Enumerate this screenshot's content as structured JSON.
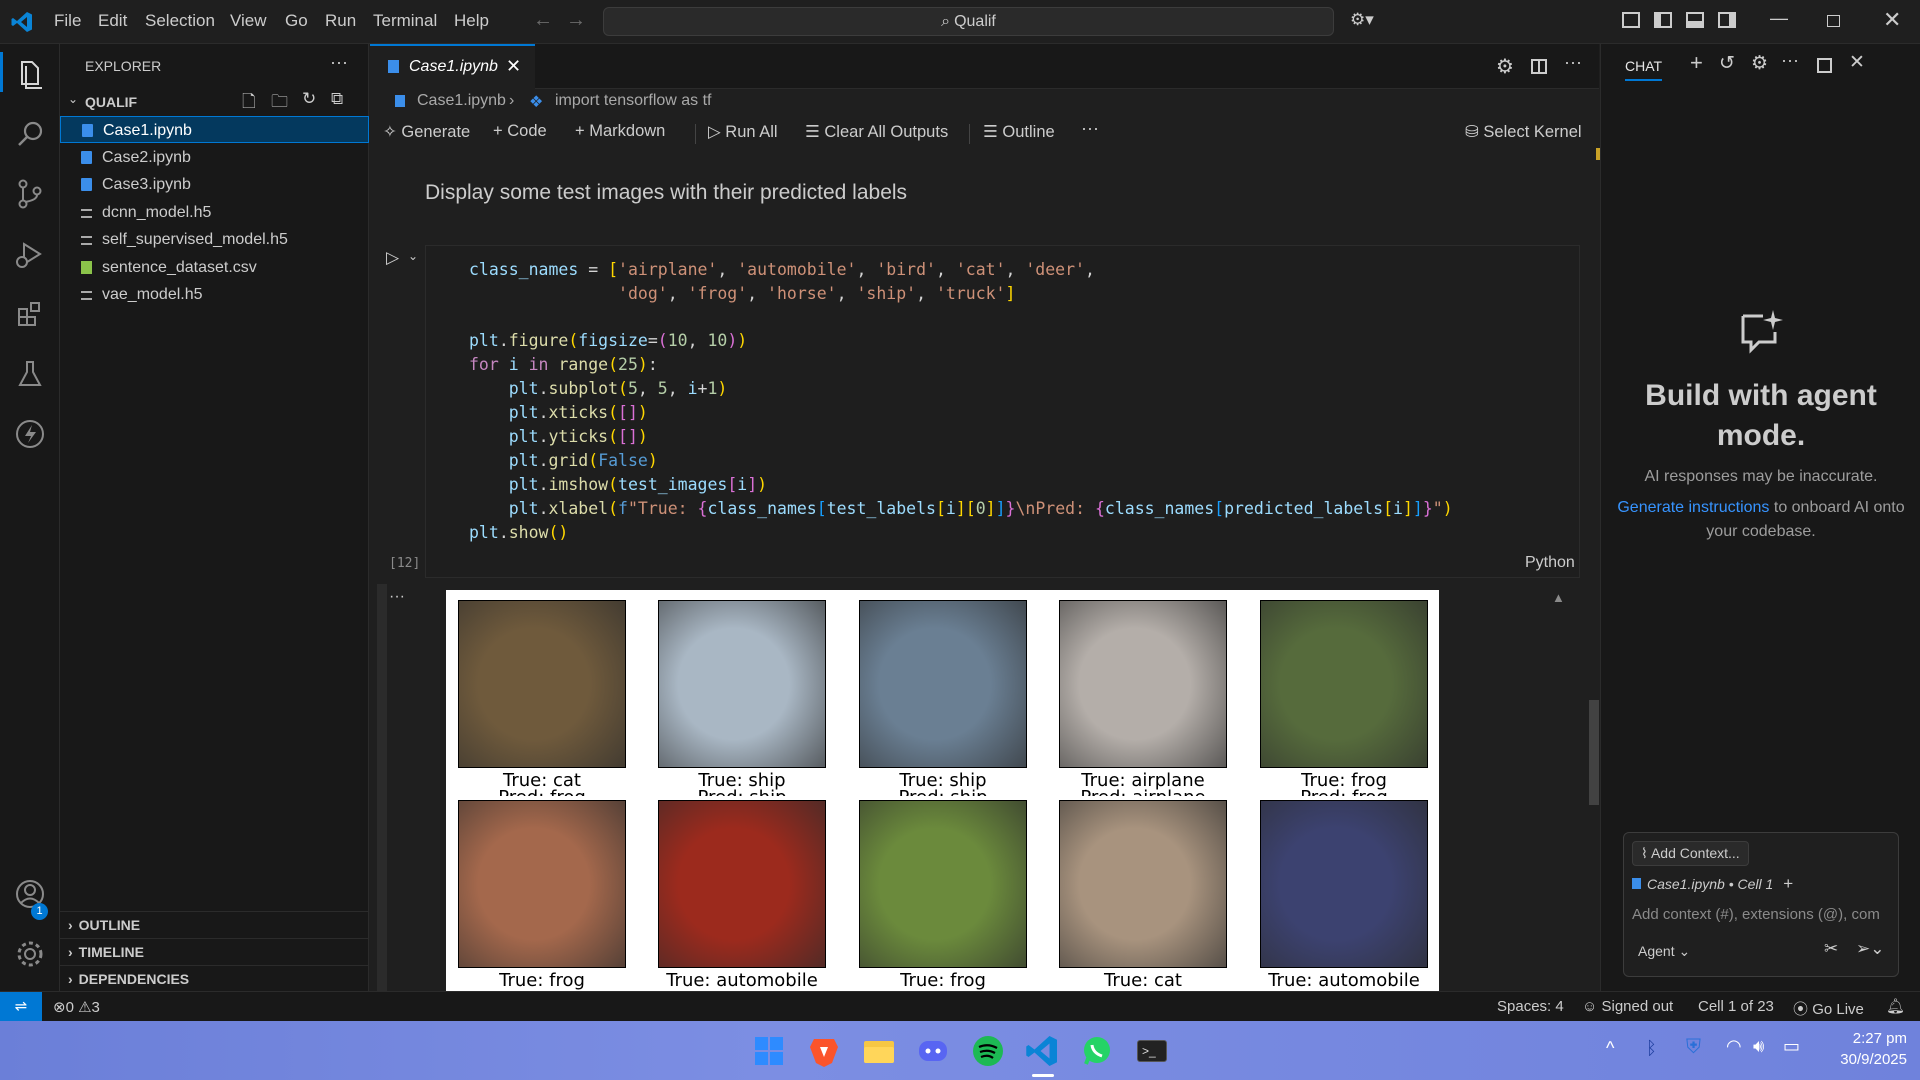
{
  "titlebar": {
    "menu": [
      "File",
      "Edit",
      "Selection",
      "View",
      "Go",
      "Run",
      "Terminal",
      "Help"
    ],
    "search": "Qualif"
  },
  "sidebar": {
    "header": "EXPLORER",
    "folder": "QUALIF",
    "files": [
      {
        "name": "Case1.ipynb",
        "type": "notebook"
      },
      {
        "name": "Case2.ipynb",
        "type": "notebook"
      },
      {
        "name": "Case3.ipynb",
        "type": "notebook"
      },
      {
        "name": "dcnn_model.h5",
        "type": "file"
      },
      {
        "name": "self_supervised_model.h5",
        "type": "file"
      },
      {
        "name": "sentence_dataset.csv",
        "type": "csv"
      },
      {
        "name": "vae_model.h5",
        "type": "file"
      }
    ],
    "sections": [
      "OUTLINE",
      "TIMELINE",
      "DEPENDENCIES"
    ],
    "accounts_badge": "1"
  },
  "editor": {
    "tab": "Case1.ipynb",
    "breadcrumb": [
      "Case1.ipynb",
      "import tensorflow as tf"
    ],
    "toolbar": {
      "generate": "Generate",
      "code": "Code",
      "markdown": "Markdown",
      "run_all": "Run All",
      "clear": "Clear All Outputs",
      "outline": "Outline",
      "kernel": "Select Kernel"
    },
    "markdown_text": "Display some test images with their predicted labels",
    "exec_count": "[12]",
    "language": "Python",
    "captions_row1": [
      "True: cat",
      "True: ship",
      "True: ship",
      "True: airplane",
      "True: frog"
    ],
    "captions_row1_cut": [
      "Pred: frog",
      "Pred: ship",
      "Pred: ship",
      "Pred: airplane",
      "Pred: frog"
    ],
    "captions_row2": [
      "True: frog",
      "True: automobile",
      "True: frog",
      "True: cat",
      "True: automobile"
    ],
    "thumb_colors": [
      "#6f5a3c",
      "#a9b7c4",
      "#6a7f93",
      "#b4aea9",
      "#566b3c",
      "#a4684c",
      "#9c2a1d",
      "#6b8a3c",
      "#a8937e",
      "#3c4270"
    ]
  },
  "chat": {
    "title": "CHAT",
    "heading": "Build with agent mode.",
    "disclaimer": "AI responses may be inaccurate.",
    "link": "Generate instructions",
    "rest": " to onboard AI onto your codebase.",
    "add_context": "Add Context...",
    "context_chip": "Case1.ipynb • Cell 1",
    "input_placeholder": "Add context (#), extensions (@), com",
    "mode": "Agent"
  },
  "statusbar": {
    "errors": "0",
    "warnings": "3",
    "spaces": "Spaces: 4",
    "signed": "Signed out",
    "cell": "Cell 1 of 23",
    "golive": "Go Live"
  },
  "taskbar": {
    "time": "2:27 pm",
    "date": "30/9/2025"
  },
  "colors": {
    "accent": "#0078d4",
    "selection": "#04395e"
  }
}
